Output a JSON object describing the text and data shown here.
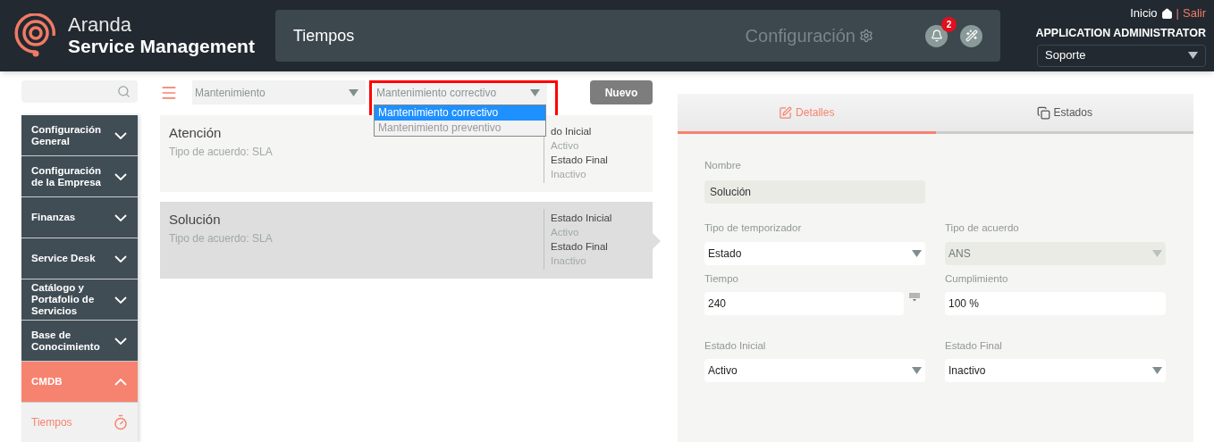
{
  "header": {
    "brand_top": "Aranda",
    "brand_bottom": "Service Management",
    "page_title": "Tiempos",
    "section_link": "Configuración",
    "notification_count": "2",
    "home_link": "Inicio",
    "separator": "|",
    "logout_link": "Salir",
    "user_name": "APPLICATION ADMINISTRATOR",
    "project_select": "Soporte"
  },
  "sidebar": {
    "items": [
      {
        "label": "Configuración General",
        "expanded": false
      },
      {
        "label": "Configuración de la Empresa",
        "expanded": false
      },
      {
        "label": "Finanzas",
        "expanded": false
      },
      {
        "label": "Service Desk",
        "expanded": false
      },
      {
        "label": "Catálogo y Portafolio de Servicios",
        "expanded": false
      },
      {
        "label": "Base de Conocimiento",
        "expanded": false
      },
      {
        "label": "CMDB",
        "expanded": true,
        "children": [
          {
            "label": "Tiempos",
            "selected": true
          }
        ]
      }
    ]
  },
  "toolbar": {
    "category_select": "Mantenimiento",
    "type_select": "Mantenimiento correctivo",
    "type_options": [
      {
        "label": "Mantenimiento correctivo",
        "selected": true
      },
      {
        "label": "Mantenimiento preventivo",
        "selected": false
      }
    ],
    "new_button": "Nuevo"
  },
  "cards": [
    {
      "name": "Atención",
      "agreement": "Tipo de acuerdo: SLA",
      "initial_label": "do Inicial",
      "initial_value": "Activo",
      "final_label": "Estado Final",
      "final_value": "Inactivo",
      "selected": false
    },
    {
      "name": "Solución",
      "agreement": "Tipo de acuerdo: SLA",
      "initial_label": "Estado Inicial",
      "initial_value": "Activo",
      "final_label": "Estado Final",
      "final_value": "Inactivo",
      "selected": true
    }
  ],
  "details": {
    "tabs": [
      {
        "label": "Detalles",
        "selected": true
      },
      {
        "label": "Estados",
        "selected": false
      }
    ],
    "name_label": "Nombre",
    "name_value": "Solución",
    "fields": [
      {
        "label": "Tipo de temporizador",
        "value": "Estado",
        "kind": "select",
        "disabled": false
      },
      {
        "label": "Tipo de acuerdo",
        "value": "ANS",
        "kind": "select",
        "disabled": true
      },
      {
        "label": "Tiempo",
        "value": "240",
        "kind": "number",
        "disabled": false
      },
      {
        "label": "Cumplimiento",
        "value": "100 %",
        "kind": "text",
        "disabled": false
      },
      {
        "label": "Estado Inicial",
        "value": "Activo",
        "kind": "select",
        "disabled": false
      },
      {
        "label": "Estado Final",
        "value": "Inactivo",
        "kind": "select",
        "disabled": false
      }
    ]
  }
}
